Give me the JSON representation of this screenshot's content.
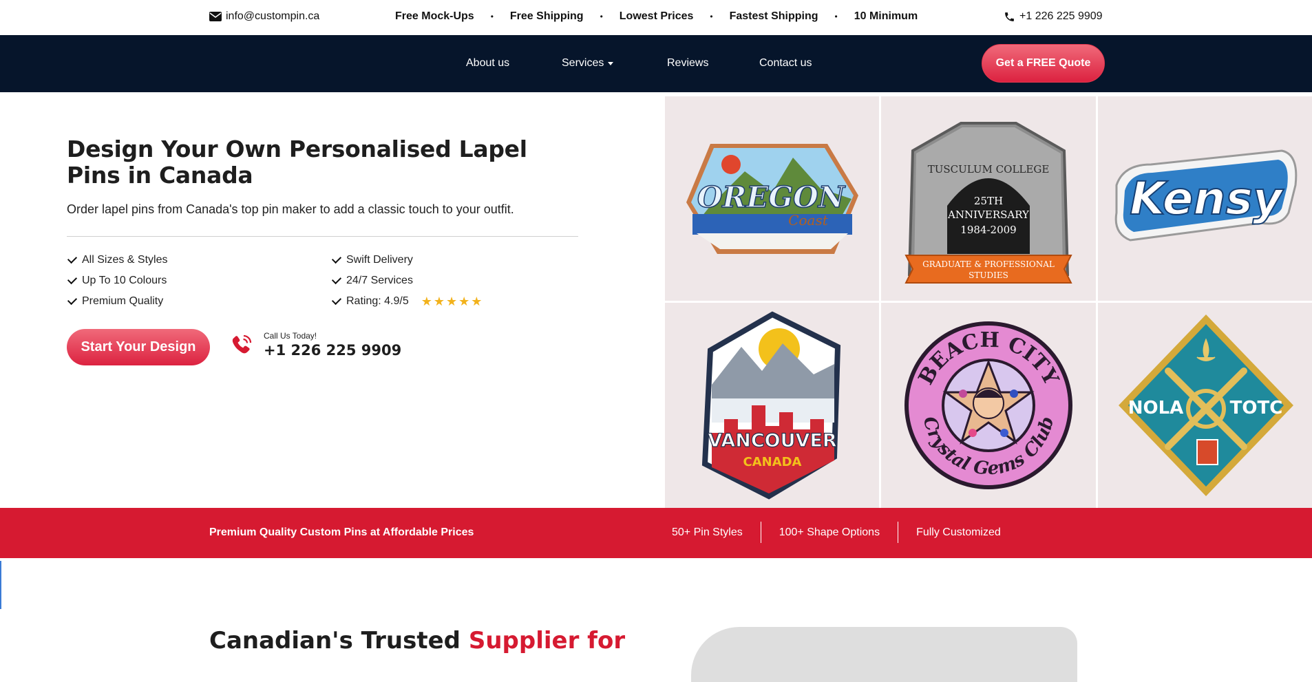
{
  "topbar": {
    "email": "info@custompin.ca",
    "perks": [
      "Free Mock-Ups",
      "Free Shipping",
      "Lowest Prices",
      "Fastest Shipping",
      "10 Minimum"
    ],
    "dot": "•",
    "phone": "+1 226 225 9909",
    "icons": {
      "email": "envelope-icon",
      "phone": "phone-icon"
    }
  },
  "nav": {
    "about": "About us",
    "services": "Services",
    "reviews": "Reviews",
    "contact": "Contact us",
    "quote_button": "Get a FREE Quote"
  },
  "hero": {
    "title": "Design Your Own Personalised Lapel Pins in Canada",
    "subtitle": "Order lapel pins from Canada's top pin maker to add a classic touch to your outfit.",
    "features_left": [
      "All Sizes & Styles",
      "Up To 10 Colours",
      "Premium Quality"
    ],
    "features_right": [
      "Swift Delivery",
      "24/7 Services",
      "Rating: 4.9/5"
    ],
    "rating_stars": 5,
    "start_button": "Start Your Design",
    "call_label": "Call Us Today!",
    "call_number": "+1 226 225 9909"
  },
  "pins": {
    "oregon": {
      "line1": "OREGON",
      "line2": "Coast"
    },
    "college": {
      "arch": "TUSCULUM COLLEGE",
      "l1": "25TH",
      "l2": "ANNIVERSARY",
      "l3": "1984-2009",
      "ribbon1": "GRADUATE & PROFESSIONAL",
      "ribbon2": "STUDIES"
    },
    "kensy": {
      "text": "Kensy"
    },
    "vancouver": {
      "l1": "VANCOUVER",
      "l2": "CANADA"
    },
    "beach": {
      "top": "BEACH CITY",
      "bottom": "Crystal Gems Club"
    },
    "nola": {
      "left": "NOLA",
      "right": "TOTC"
    }
  },
  "band": {
    "tagline": "Premium Quality Custom Pins at Affordable Prices",
    "stats": [
      "50+ Pin Styles",
      "100+ Shape Options",
      "Fully Customized"
    ]
  },
  "section2": {
    "heading_plain": "Canadian's Trusted ",
    "heading_highlight": "Supplier for"
  },
  "colors": {
    "navy": "#06152b",
    "brand_red": "#d61a31",
    "button_gradient_top": "#f06a7a",
    "star_gold": "#f2b21c",
    "tile_bg": "#efe7e8"
  }
}
